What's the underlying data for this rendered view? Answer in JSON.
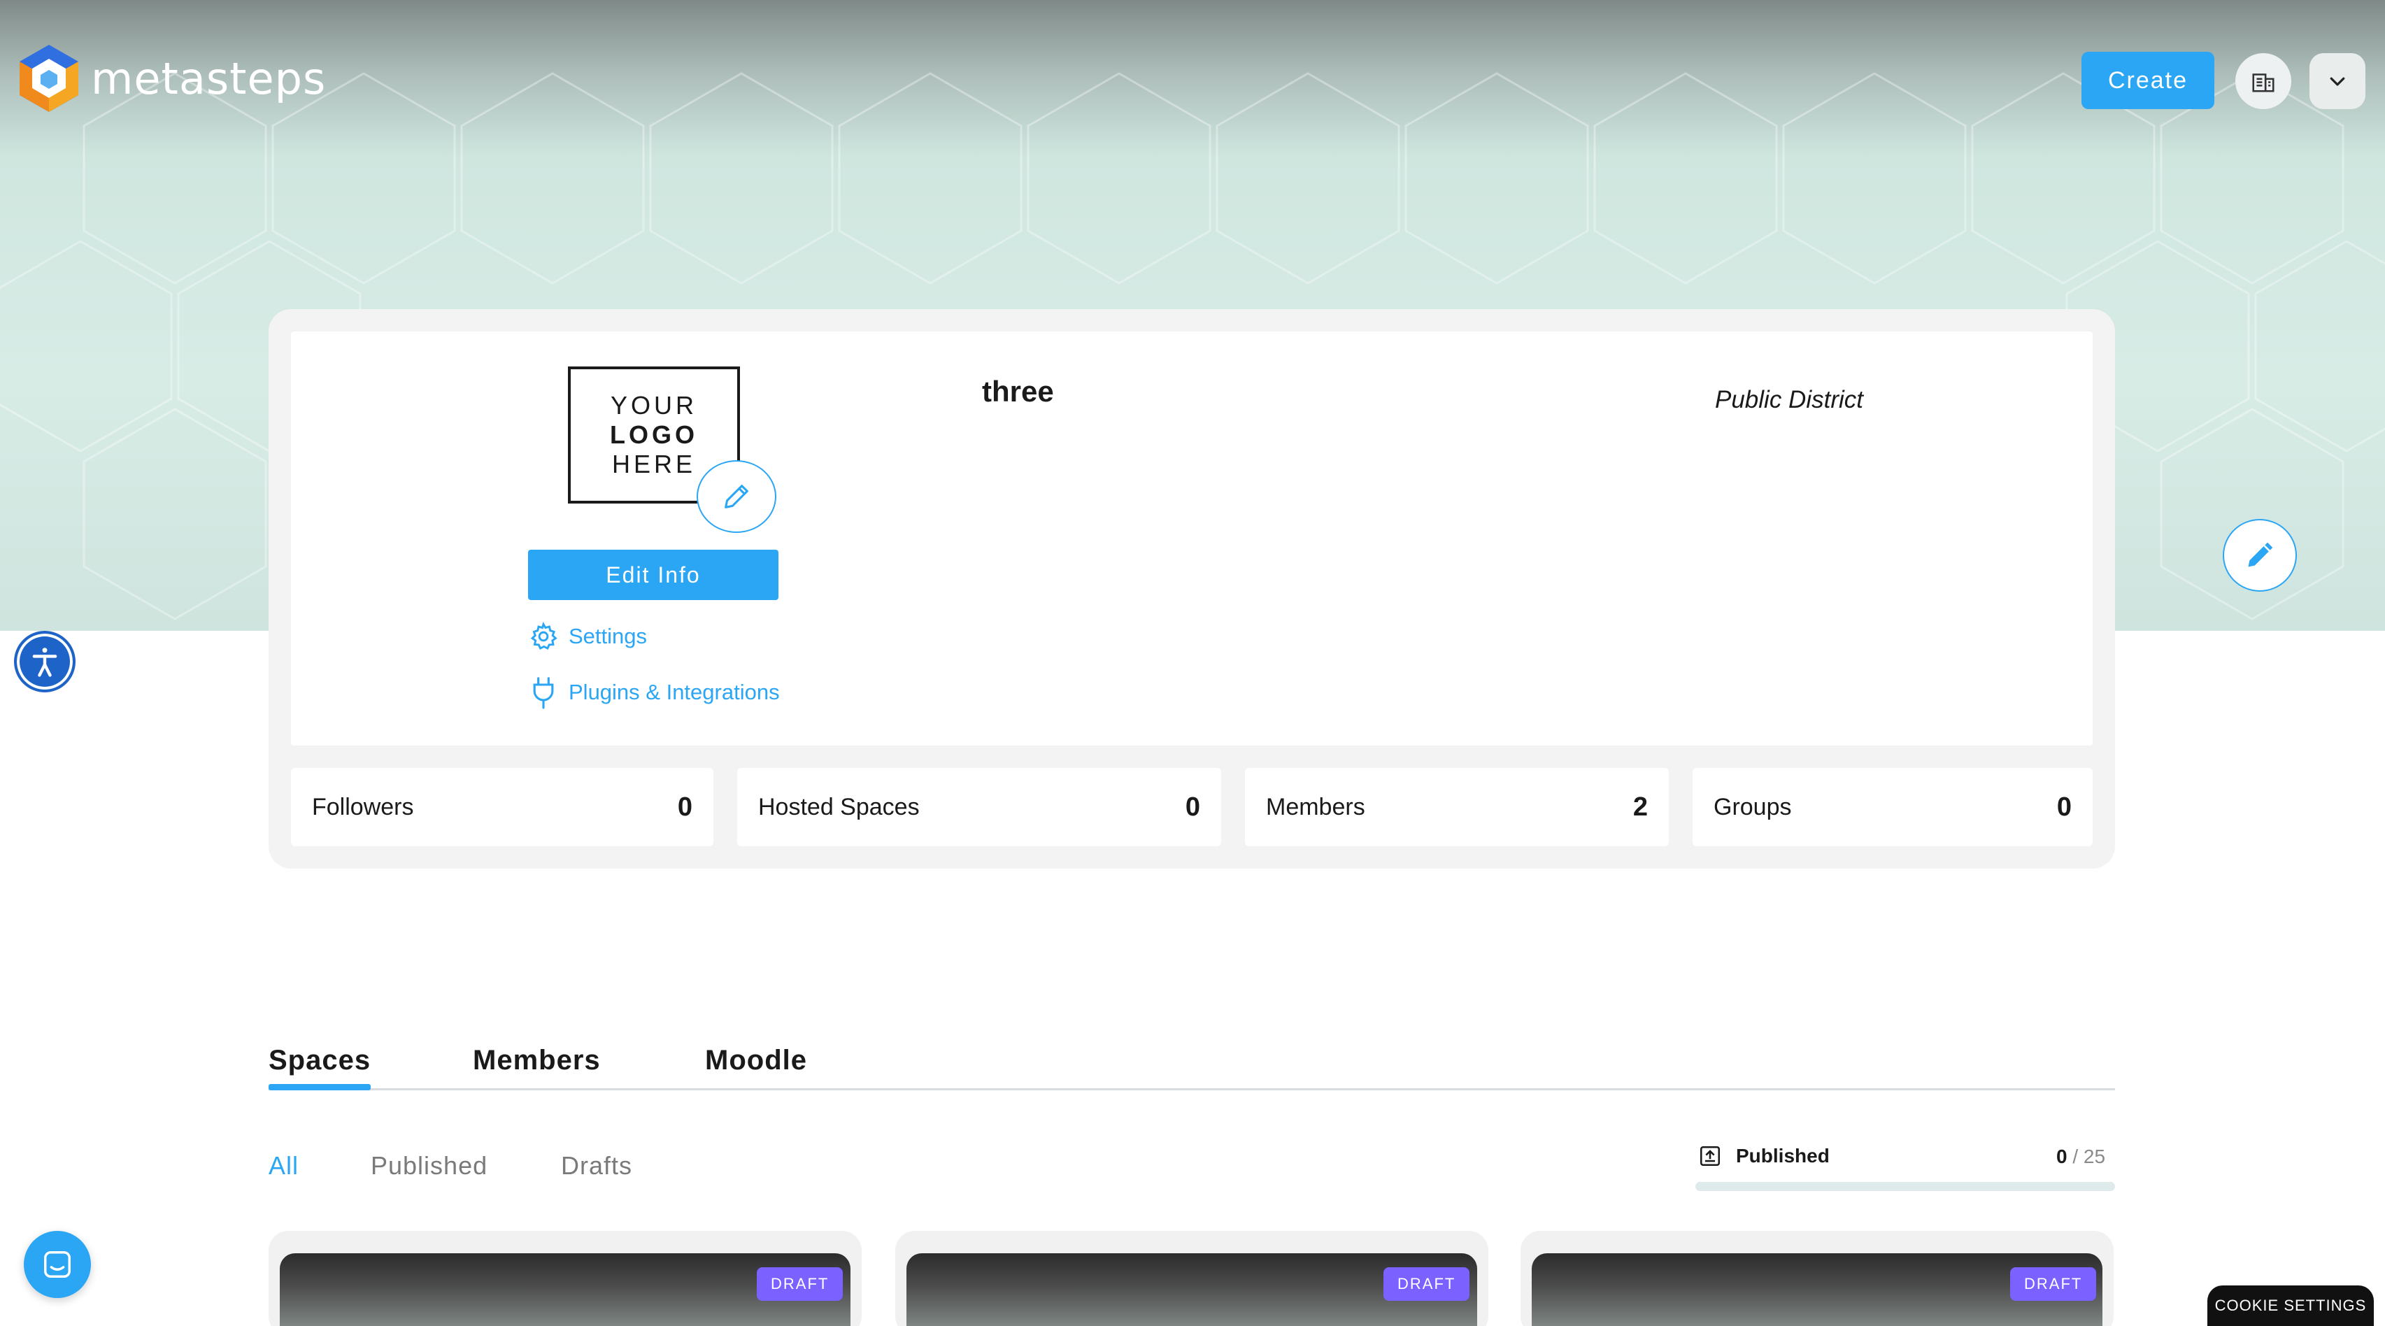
{
  "brand": {
    "name": "metasteps"
  },
  "header": {
    "create_label": "Create"
  },
  "profile": {
    "logo_placeholder": {
      "line1": "YOUR",
      "line2": "LOGO",
      "line3": "HERE"
    },
    "edit_info_label": "Edit Info",
    "settings_label": "Settings",
    "plugins_label": "Plugins & Integrations",
    "name": "three",
    "district_type": "Public District"
  },
  "stats": [
    {
      "label": "Followers",
      "value": "0"
    },
    {
      "label": "Hosted Spaces",
      "value": "0"
    },
    {
      "label": "Members",
      "value": "2"
    },
    {
      "label": "Groups",
      "value": "0"
    }
  ],
  "tabs": [
    {
      "label": "Spaces",
      "active": true
    },
    {
      "label": "Members",
      "active": false
    },
    {
      "label": "Moodle",
      "active": false
    }
  ],
  "filters": [
    {
      "label": "All",
      "active": true
    },
    {
      "label": "Published",
      "active": false
    },
    {
      "label": "Drafts",
      "active": false
    }
  ],
  "published_quota": {
    "label": "Published",
    "count": "0",
    "limit": "/ 25",
    "fraction": 0.0
  },
  "space_cards": [
    {
      "badge": "DRAFT"
    },
    {
      "badge": "DRAFT"
    },
    {
      "badge": "DRAFT"
    }
  ],
  "cookie_settings_label": "COOKIE SETTINGS",
  "colors": {
    "accent": "#2aa6f5",
    "draft_badge": "#7b61ff",
    "a11y": "#1e63c7"
  },
  "icons": [
    "metasteps-logo-icon",
    "building-icon",
    "chevron-down-icon",
    "pencil-icon",
    "gear-icon",
    "plug-icon",
    "accessibility-icon",
    "archive-box-icon",
    "chat-icon"
  ]
}
